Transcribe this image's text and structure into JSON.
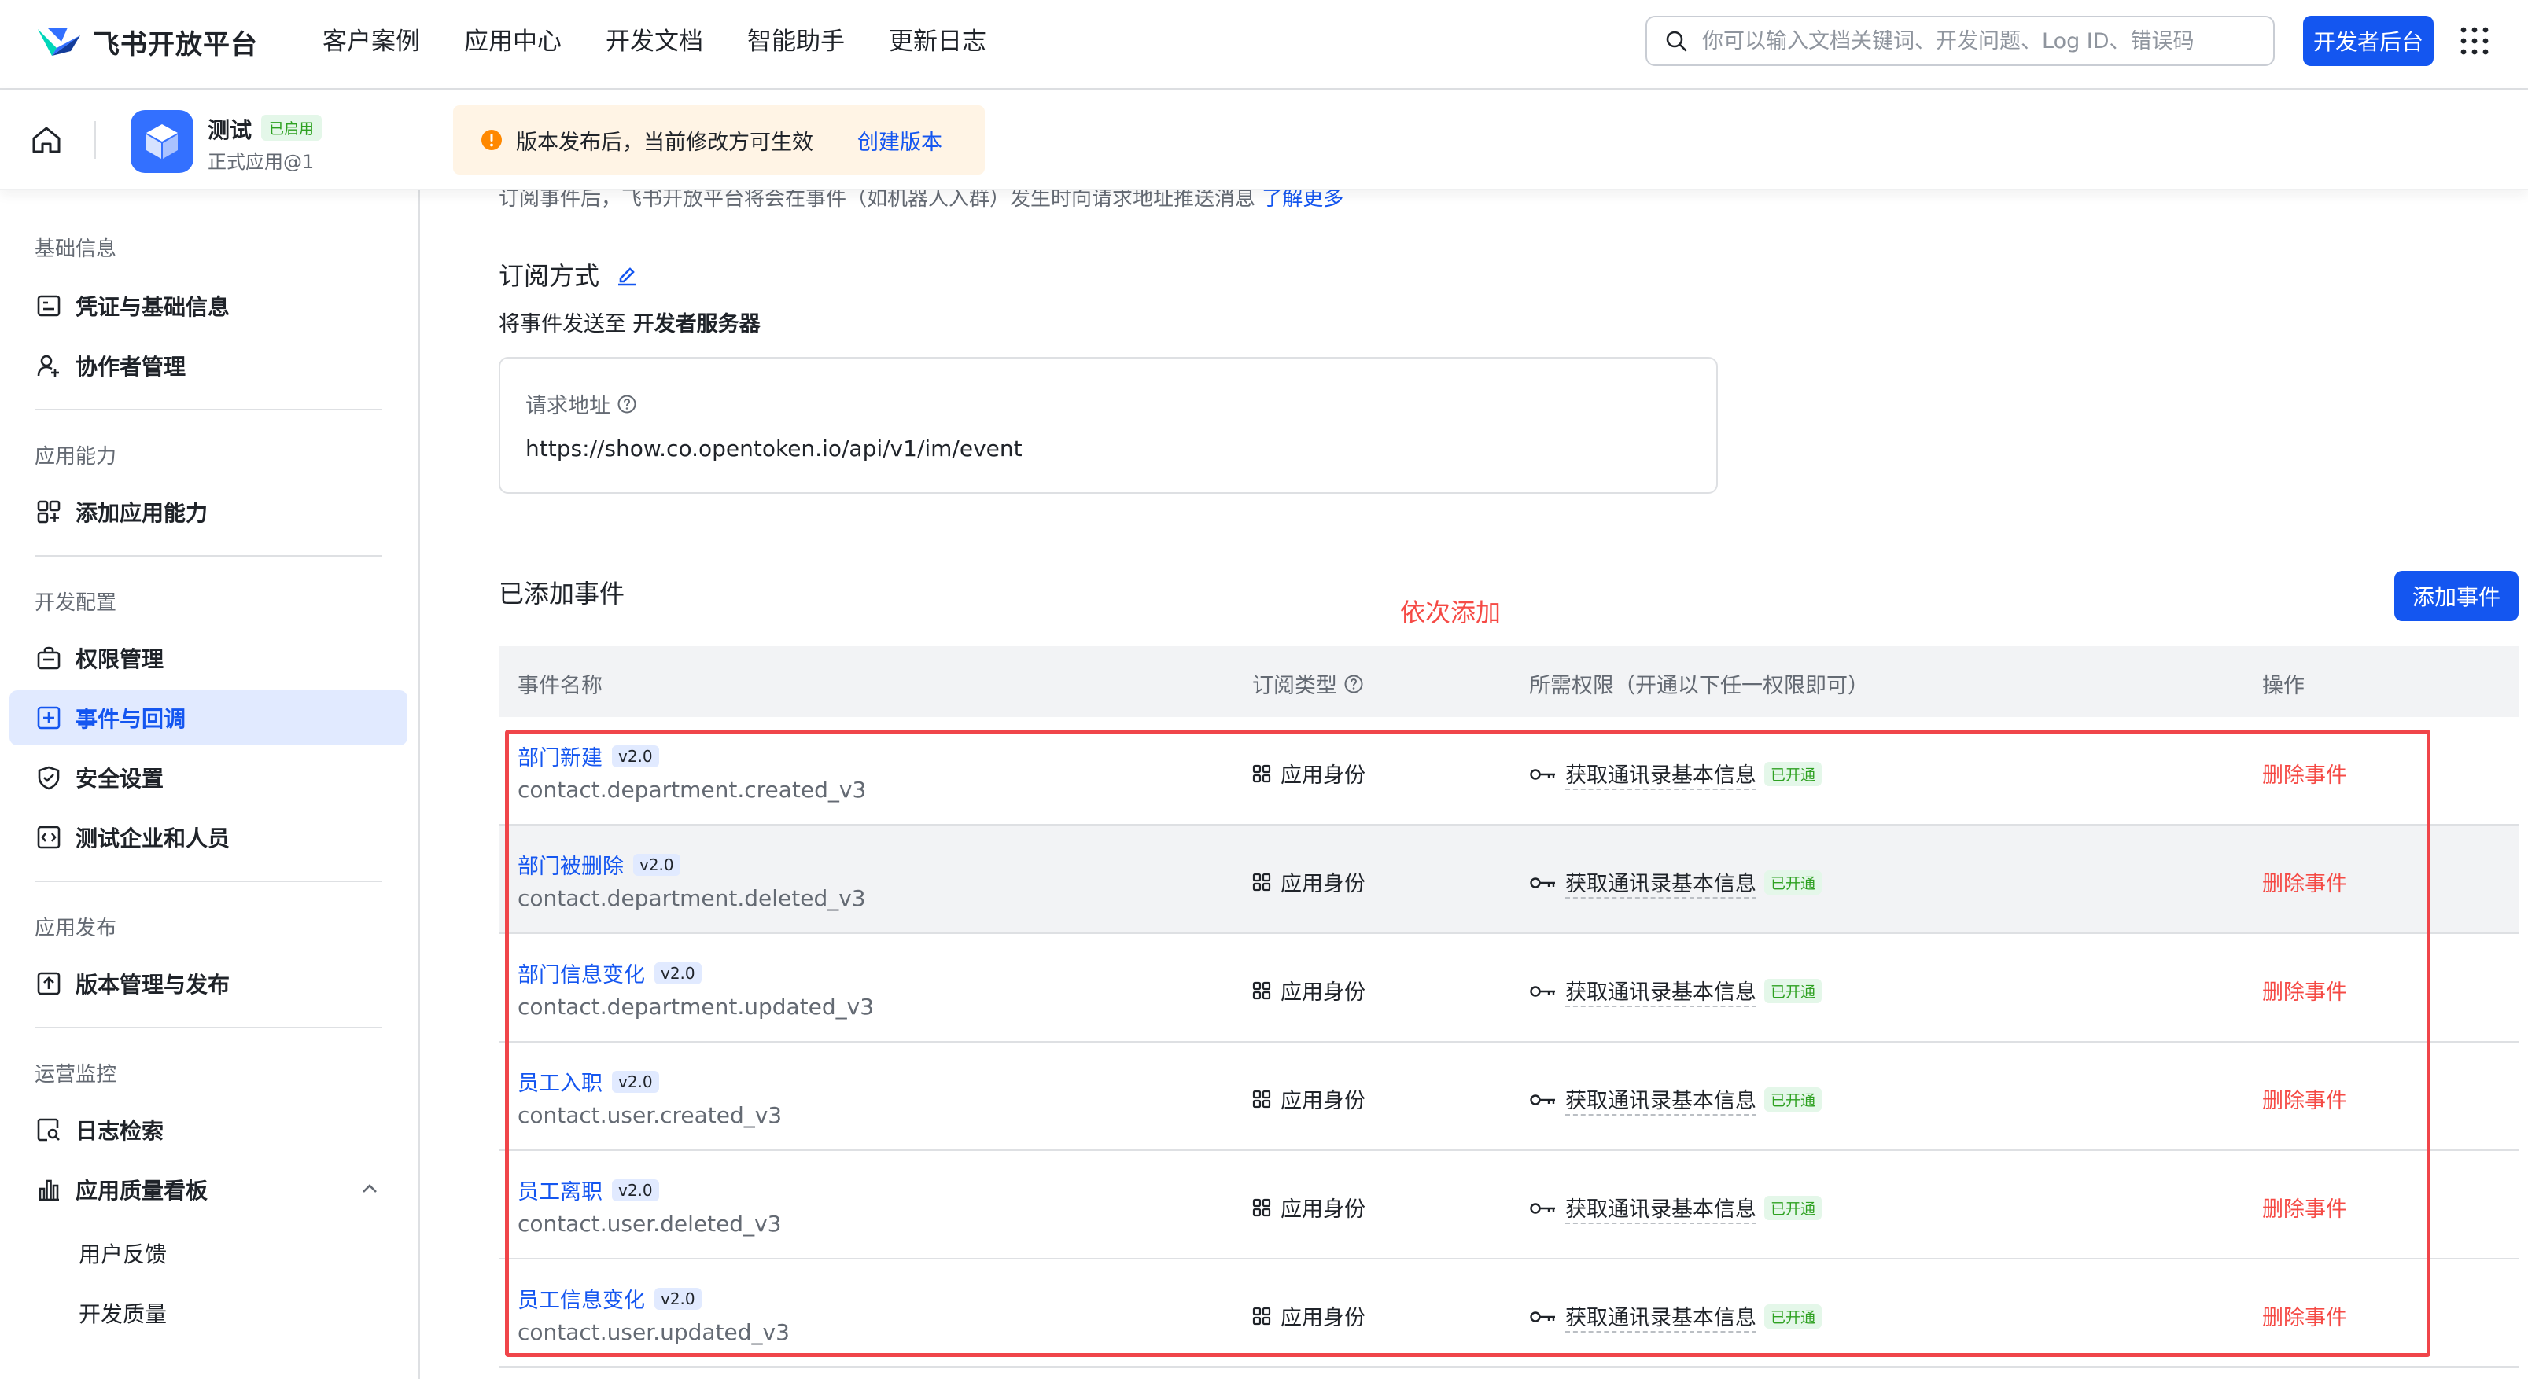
{
  "topnav": {
    "logo_text": "飞书开放平台",
    "menu": [
      "客户案例",
      "应用中心",
      "开发文档",
      "智能助手",
      "更新日志"
    ],
    "search_placeholder": "你可以输入文档关键词、开发问题、Log ID、错误码",
    "dev_console": "开发者后台"
  },
  "app": {
    "name": "测试",
    "status": "已启用",
    "version": "正式应用@1"
  },
  "notice": {
    "text": "版本发布后，当前修改方可生效",
    "link": "创建版本"
  },
  "sidebar": {
    "groups": [
      {
        "title": "基础信息",
        "items": [
          {
            "label": "凭证与基础信息",
            "icon": "credential-icon"
          },
          {
            "label": "协作者管理",
            "icon": "user-add-icon"
          }
        ]
      },
      {
        "title": "应用能力",
        "items": [
          {
            "label": "添加应用能力",
            "icon": "app-ability-icon"
          }
        ]
      },
      {
        "title": "开发配置",
        "items": [
          {
            "label": "权限管理",
            "icon": "permission-icon"
          },
          {
            "label": "事件与回调",
            "icon": "event-icon",
            "active": true
          },
          {
            "label": "安全设置",
            "icon": "shield-icon"
          },
          {
            "label": "测试企业和人员",
            "icon": "test-icon"
          }
        ]
      },
      {
        "title": "应用发布",
        "items": [
          {
            "label": "版本管理与发布",
            "icon": "upload-icon"
          }
        ]
      },
      {
        "title": "运营监控",
        "items": [
          {
            "label": "日志检索",
            "icon": "log-search-icon"
          },
          {
            "label": "应用质量看板",
            "icon": "chart-icon"
          }
        ]
      }
    ],
    "sub_items": [
      "用户反馈",
      "开发质量"
    ]
  },
  "main": {
    "cut_text": "订阅事件后，飞书开放平台将会在事件（如机器人入群）发生时向请求地址推送消息",
    "cut_link": "了解更多",
    "subscribe_title": "订阅方式",
    "send_prefix": "将事件发送至",
    "send_target": "开发者服务器",
    "url_label": "请求地址",
    "url_value": "https://show.co.opentoken.io/api/v1/im/event",
    "added_title": "已添加事件",
    "annotation": "依次添加",
    "add_button": "添加事件"
  },
  "table": {
    "headers": [
      "事件名称",
      "订阅类型",
      "所需权限（开通以下任一权限即可）",
      "操作"
    ],
    "rows": [
      {
        "name": "部门新建",
        "version": "v2.0",
        "key": "contact.department.created_v3",
        "type": "应用身份",
        "perm": "获取通讯录基本信息",
        "perm_status": "已开通",
        "action": "删除事件"
      },
      {
        "name": "部门被删除",
        "version": "v2.0",
        "key": "contact.department.deleted_v3",
        "type": "应用身份",
        "perm": "获取通讯录基本信息",
        "perm_status": "已开通",
        "action": "删除事件"
      },
      {
        "name": "部门信息变化",
        "version": "v2.0",
        "key": "contact.department.updated_v3",
        "type": "应用身份",
        "perm": "获取通讯录基本信息",
        "perm_status": "已开通",
        "action": "删除事件"
      },
      {
        "name": "员工入职",
        "version": "v2.0",
        "key": "contact.user.created_v3",
        "type": "应用身份",
        "perm": "获取通讯录基本信息",
        "perm_status": "已开通",
        "action": "删除事件"
      },
      {
        "name": "员工离职",
        "version": "v2.0",
        "key": "contact.user.deleted_v3",
        "type": "应用身份",
        "perm": "获取通讯录基本信息",
        "perm_status": "已开通",
        "action": "删除事件"
      },
      {
        "name": "员工信息变化",
        "version": "v2.0",
        "key": "contact.user.updated_v3",
        "type": "应用身份",
        "perm": "获取通讯录基本信息",
        "perm_status": "已开通",
        "action": "删除事件"
      }
    ]
  },
  "colors": {
    "primary": "#1456f0",
    "danger": "#f54a45",
    "success": "#2ea121",
    "annotation_box": "#f0454a"
  }
}
